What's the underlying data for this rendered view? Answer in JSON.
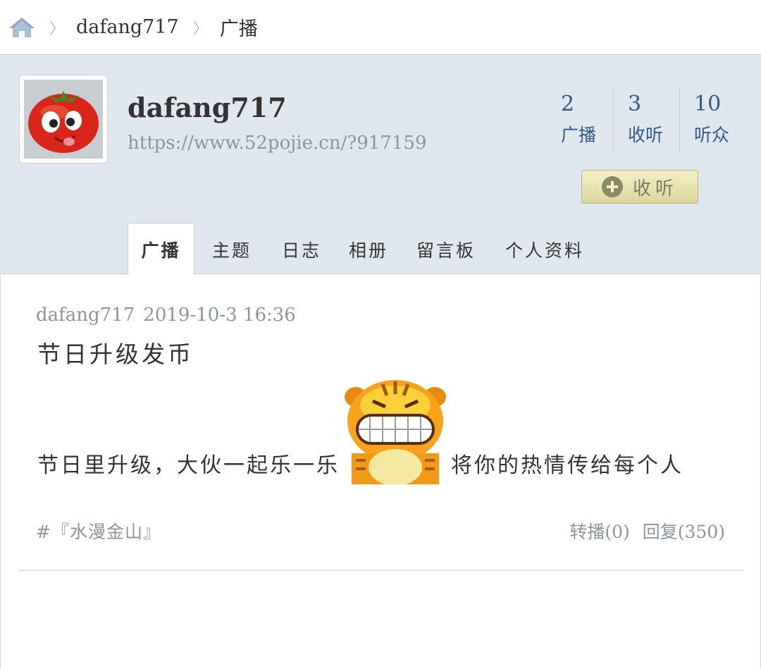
{
  "breadcrumb": {
    "icon": "home-icon",
    "separator": "〉",
    "items": [
      "dafang717",
      "广播"
    ]
  },
  "profile": {
    "username": "dafang717",
    "url": "https://www.52pojie.cn/?917159",
    "stats": [
      {
        "num": "2",
        "label": "广播"
      },
      {
        "num": "3",
        "label": "收听"
      },
      {
        "num": "10",
        "label": "听众"
      }
    ],
    "follow_label": "收听",
    "tabs": [
      "广播",
      "主题",
      "日志",
      "相册",
      "留言板",
      "个人资料"
    ],
    "active_tab": "广播"
  },
  "post": {
    "author": "dafang717",
    "time": "2019-10-3 16:36",
    "title": "节日升级发币",
    "body_before": "节日里升级，大伙一起乐一乐",
    "body_after": "将你的热情传给每个人",
    "tag": "#『水漫金山』",
    "forward": "转播(0)",
    "reply": "回复(350)"
  },
  "colors": {
    "header_bg": "#e1e7ef",
    "stat_blue": "#2f5b8a",
    "muted": "#8c949c",
    "follow_btn": "#ddd79b"
  }
}
